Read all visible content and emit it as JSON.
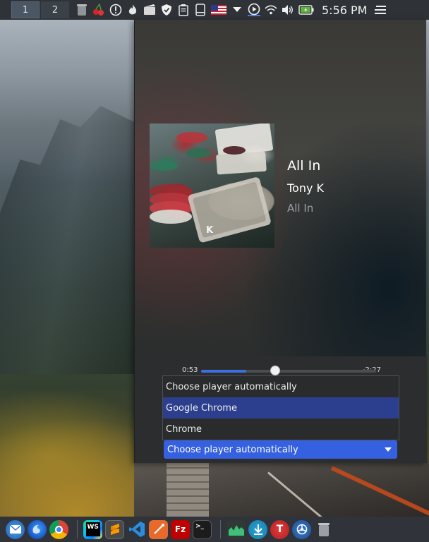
{
  "panel": {
    "desktops": [
      "1",
      "2"
    ],
    "clock": "5:56 PM"
  },
  "tray_icons": [
    "trash-icon",
    "cherry-icon",
    "alert-icon",
    "flame-icon",
    "screenshot-icon",
    "shield-icon",
    "clipboard-icon",
    "drive-icon",
    "us-flag-icon",
    "dropdown-arrow-icon",
    "media-play-icon",
    "wifi-icon",
    "volume-icon",
    "battery-icon"
  ],
  "media": {
    "title": "All In",
    "artist": "Tony K",
    "album": "All In",
    "elapsed": "0:53",
    "remaining": "-2:27",
    "progress": 0.26
  },
  "player_dropdown": {
    "options": [
      "Choose player automatically",
      "Google Chrome",
      "Chrome"
    ],
    "highlighted": "Google Chrome",
    "selected": "Choose player automatically"
  },
  "colors": {
    "accent": "#3560e0",
    "panel_bg": "#2f3338",
    "highlight": "#2c3f8e"
  },
  "dock_apps": [
    "mail-app-icon",
    "firefox-icon",
    "chrome-icon",
    "webstorm-icon",
    "sublime-text-icon",
    "vscode-icon",
    "postman-icon",
    "filezilla-icon",
    "terminal-icon",
    "system-monitor-icon",
    "downloader-icon",
    "typora-icon",
    "settings-icon",
    "dock-trash-icon"
  ]
}
